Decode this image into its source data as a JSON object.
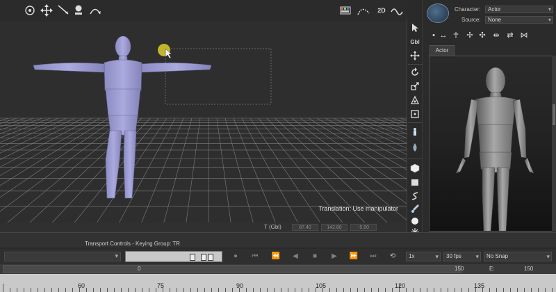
{
  "viewport": {
    "status_text": "Translation: Use manipulator",
    "coord_label": "T (Gbl)",
    "coords": [
      "87.40",
      "142.80",
      "-5.90"
    ]
  },
  "toolbar": {
    "tools": [
      "dots-view-icon",
      "move-icon",
      "line-tool-icon",
      "pin-icon",
      "arc-icon"
    ],
    "right_tools": [
      "palette-icon",
      "curve-icon",
      "2d-icon",
      "wave-icon"
    ]
  },
  "tool_strip": {
    "gbl_label": "Gbl"
  },
  "right_panel": {
    "character_label": "Character:",
    "character_value": "Actor",
    "source_label": "Source:",
    "source_value": "None",
    "tab_label": "Actor"
  },
  "transport": {
    "title": "Transport Controls  -  Keying Group: TR",
    "speed": "1x",
    "fps": "30 fps",
    "snap": "No Snap"
  },
  "timeline": {
    "start": "0",
    "end": "150",
    "e_label": "E:",
    "e_value": "150",
    "ticks": [
      "60",
      "75",
      "90",
      "105",
      "120",
      "135"
    ]
  }
}
